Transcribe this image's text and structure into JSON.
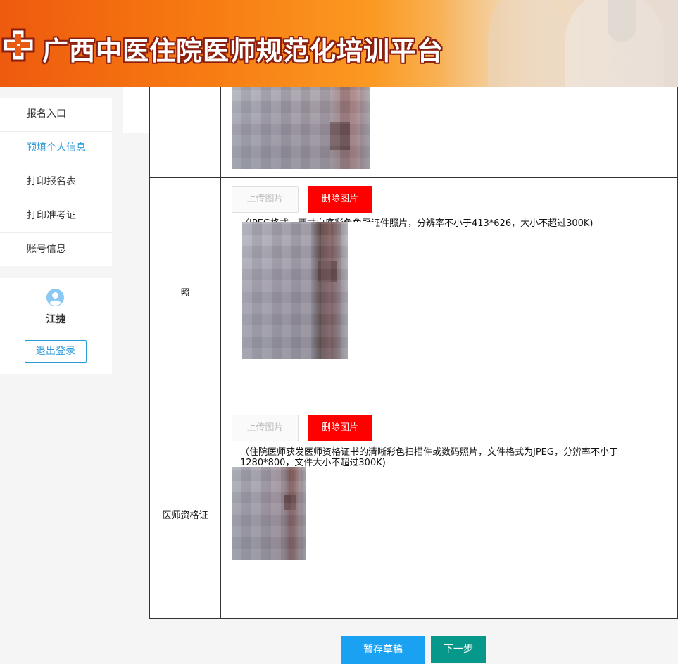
{
  "header": {
    "site_title": "广西中医住院医师规范化培训平台",
    "logo_icon": "cross-logo-icon"
  },
  "sidebar": {
    "items": [
      {
        "label": "报名入口"
      },
      {
        "label": "预填个人信息",
        "active": true
      },
      {
        "label": "打印报名表"
      },
      {
        "label": "打印准考证"
      },
      {
        "label": "账号信息"
      }
    ],
    "active_color": "#2d9ad9"
  },
  "user": {
    "avatar_icon": "user-avatar-icon",
    "name": "江捷",
    "logout_label": "退出登录"
  },
  "form": {
    "rows": [
      {
        "label": "",
        "upload_label": "",
        "delete_label": "",
        "hint": ""
      },
      {
        "label": "照",
        "upload_label": "上传图片",
        "delete_label": "删除图片",
        "hint": "（JPEG格式，两寸白底彩色免冠证件照片，分辨率不小于413*626，大小不超过300K)"
      },
      {
        "label": "医师资格证",
        "upload_label": "上传图片",
        "delete_label": "删除图片",
        "hint_line1": "（住院医师获发医师资格证书的清晰彩色扫描件或数码照片，文件格式为JPEG，分辨率不小于",
        "hint_line2": "1280*800，文件大小不超过300K)"
      }
    ]
  },
  "actions": {
    "draft_label": "暂存草稿",
    "next_label": "下一步"
  },
  "colors": {
    "delete_red": "#ff0000",
    "draft_blue": "#1ba1f2",
    "next_teal": "#06998b",
    "header_orange": "#f77b12"
  }
}
